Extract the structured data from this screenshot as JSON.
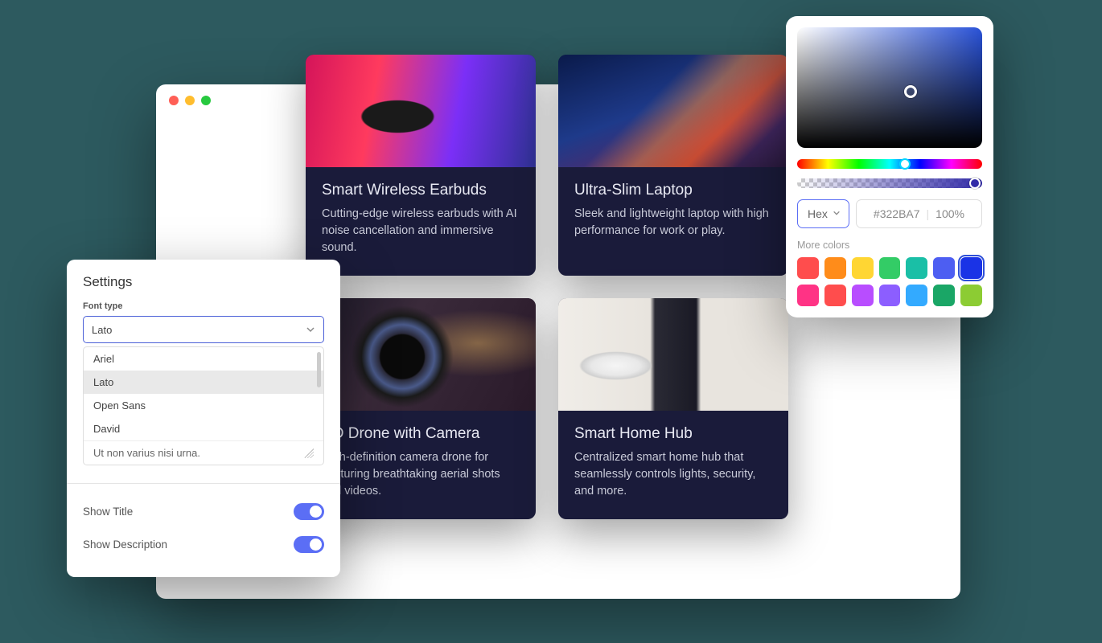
{
  "cards": [
    {
      "title": "Smart Wireless Earbuds",
      "description": "Cutting-edge wireless earbuds with AI noise cancellation and immersive sound."
    },
    {
      "title": "Ultra-Slim Laptop",
      "description": "Sleek and lightweight laptop with high performance for work or play."
    },
    {
      "title": "HD Drone with Camera",
      "description": "High-definition camera drone for capturing breathtaking aerial shots and videos."
    },
    {
      "title": "Smart Home Hub",
      "description": "Centralized smart home hub that seamlessly controls lights, security, and more."
    }
  ],
  "settings": {
    "title": "Settings",
    "font_type_label": "Font type",
    "selected_font": "Lato",
    "font_options": [
      "Ariel",
      "Lato",
      "Open Sans",
      "David"
    ],
    "dropdown_footer": "Ut non varius nisi urna.",
    "show_title_label": "Show Title",
    "show_description_label": "Show Description",
    "show_title_on": true,
    "show_description_on": true
  },
  "color_picker": {
    "format_label": "Hex",
    "hex_value": "#322BA7",
    "alpha_value": "100%",
    "more_colors_label": "More colors",
    "swatches": [
      "#ff4d4d",
      "#ff8c1a",
      "#ffd633",
      "#33cc66",
      "#1abfa6",
      "#4d5ef2",
      "#1a33e6",
      "#ff3385",
      "#ff4d4d",
      "#b84dff",
      "#8c5eff",
      "#33aaff",
      "#1aa666",
      "#8ccc33"
    ],
    "active_swatch_index": 6
  }
}
